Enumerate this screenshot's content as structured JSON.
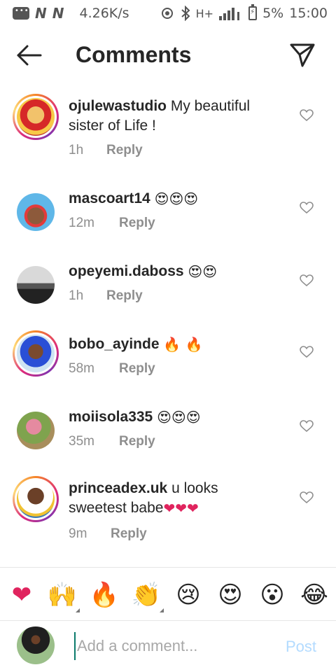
{
  "status_bar": {
    "speed": "4.26K/s",
    "network": "H+",
    "battery": "5%",
    "time": "15:00"
  },
  "header": {
    "title": "Comments"
  },
  "comments": [
    {
      "user": "ojulewastudio",
      "text": "My beautiful sister of Life !",
      "emoji": "",
      "time": "1h",
      "reply": "Reply"
    },
    {
      "user": "mascoart14",
      "text": "",
      "emoji": "😍😍😍",
      "time": "12m",
      "reply": "Reply"
    },
    {
      "user": "opeyemi.daboss",
      "text": "",
      "emoji": "😍😍",
      "time": "1h",
      "reply": "Reply"
    },
    {
      "user": "bobo_ayinde",
      "text": "",
      "emoji": "🔥 🔥",
      "time": "58m",
      "reply": "Reply"
    },
    {
      "user": "moiisola335",
      "text": "",
      "emoji": "😍😍😍",
      "time": "35m",
      "reply": "Reply"
    },
    {
      "user": "princeadex.uk",
      "text": "u looks sweetest babe",
      "emoji": "❤❤❤",
      "time": "9m",
      "reply": "Reply"
    }
  ],
  "emoji_bar": [
    "❤",
    "🙌",
    "🔥",
    "👏",
    "😢",
    "😍",
    "😮",
    "😂"
  ],
  "input": {
    "placeholder": "Add a comment...",
    "post_label": "Post"
  },
  "colors": {
    "accent_post": "#b3dbff",
    "muted": "#8e8e8e",
    "heart_red": "#e0245e"
  }
}
